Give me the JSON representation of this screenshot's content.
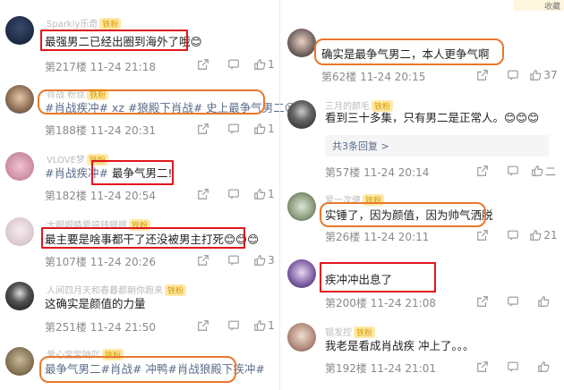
{
  "top_badge": "收藏",
  "left": [
    {
      "nickname": "Sparkly乐奇",
      "tag": "铁粉",
      "text": "最强男二已经出圈到海外了哦😊",
      "meta": "第217楼 11-24 21:18",
      "likes": "1"
    },
    {
      "nickname": "肖战 粉丝",
      "tag": "铁粉",
      "text": "#肖战疾冲# xz #狼殿下肖战# 史上最争气男二😉",
      "meta": "第188楼 11-24 20:31",
      "likes": "1"
    },
    {
      "nickname": "VLOVE梦",
      "tag": "铁粉",
      "text_prefix": "#肖战疾冲#",
      "text_suffix": "最争气男二!",
      "meta": "第182楼 11-24 20:54",
      "likes": "1"
    },
    {
      "nickname": "大眼眼睛要搞钱嗯嗯",
      "tag": "铁粉",
      "text": "最主要是啥事都干了还没被男主打死😊😊😊",
      "meta": "第107楼 11-24 20:26",
      "likes": "3"
    },
    {
      "nickname": "人间四月天和春暮都朝你跑来",
      "tag": "铁粉",
      "text": "这确实是颜值的力量",
      "meta": "第251楼 11-24 21:50",
      "likes": "1"
    },
    {
      "nickname": "爱心宝宝呐吖",
      "tag": "铁粉",
      "text": "最争气男二#肖战# 冲鸭#肖战狼殿下疾冲#",
      "meta": "",
      "likes": ""
    }
  ],
  "right": [
    {
      "nickname": "",
      "tag": "",
      "text": "确实是最争气男二，本人更争气啊",
      "meta": "第62楼 11-24 20:15",
      "likes": "37"
    },
    {
      "nickname": "三月的颜毛",
      "tag": "铁粉",
      "text": "看到三十多集，只有男二是正常人。😊😊😊",
      "replies": "共3条回复 >",
      "meta": "第57楼 11-24 20:14",
      "likes": "二"
    },
    {
      "nickname": "爱一次便",
      "tag": "铁粉",
      "text": "实锤了，因为颜值，因为帅气洒脱",
      "meta": "第26楼 11-24 20:11",
      "likes": "21"
    },
    {
      "nickname": "",
      "tag": "",
      "text": "疾冲冲出息了",
      "meta": "第200楼 11-24 21:08",
      "likes": ""
    },
    {
      "nickname": "银发控",
      "tag": "铁粉",
      "text": "我老是看成肖战疾  冲上了。。。",
      "meta": "第192楼 11-24 21:01",
      "likes": ""
    }
  ]
}
